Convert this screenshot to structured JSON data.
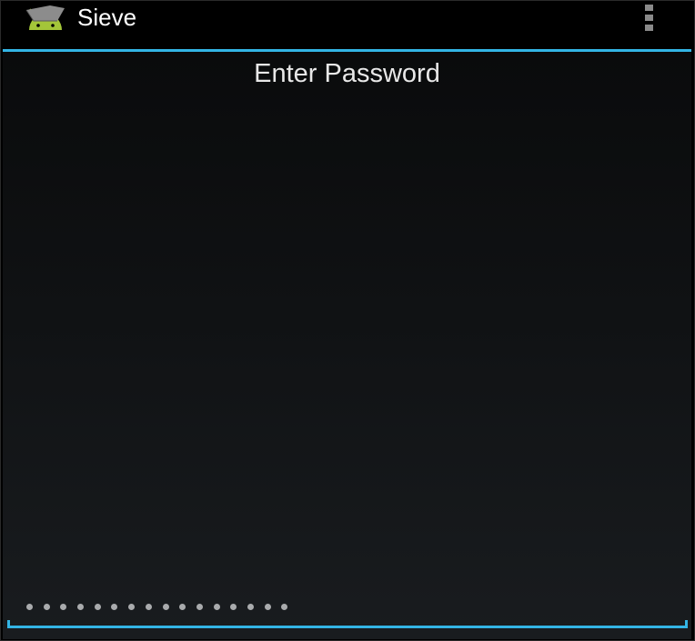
{
  "app": {
    "title": "Sieve",
    "icon": "android-icon"
  },
  "action_bar": {
    "overflow_icon": "overflow-menu-icon"
  },
  "main": {
    "prompt": "Enter Password"
  },
  "password_field": {
    "masked_length": 16
  },
  "colors": {
    "accent": "#33b5e5",
    "android_green": "#a4c639",
    "background": "#000000",
    "text": "#ffffff",
    "password_dot": "#a9abad"
  }
}
